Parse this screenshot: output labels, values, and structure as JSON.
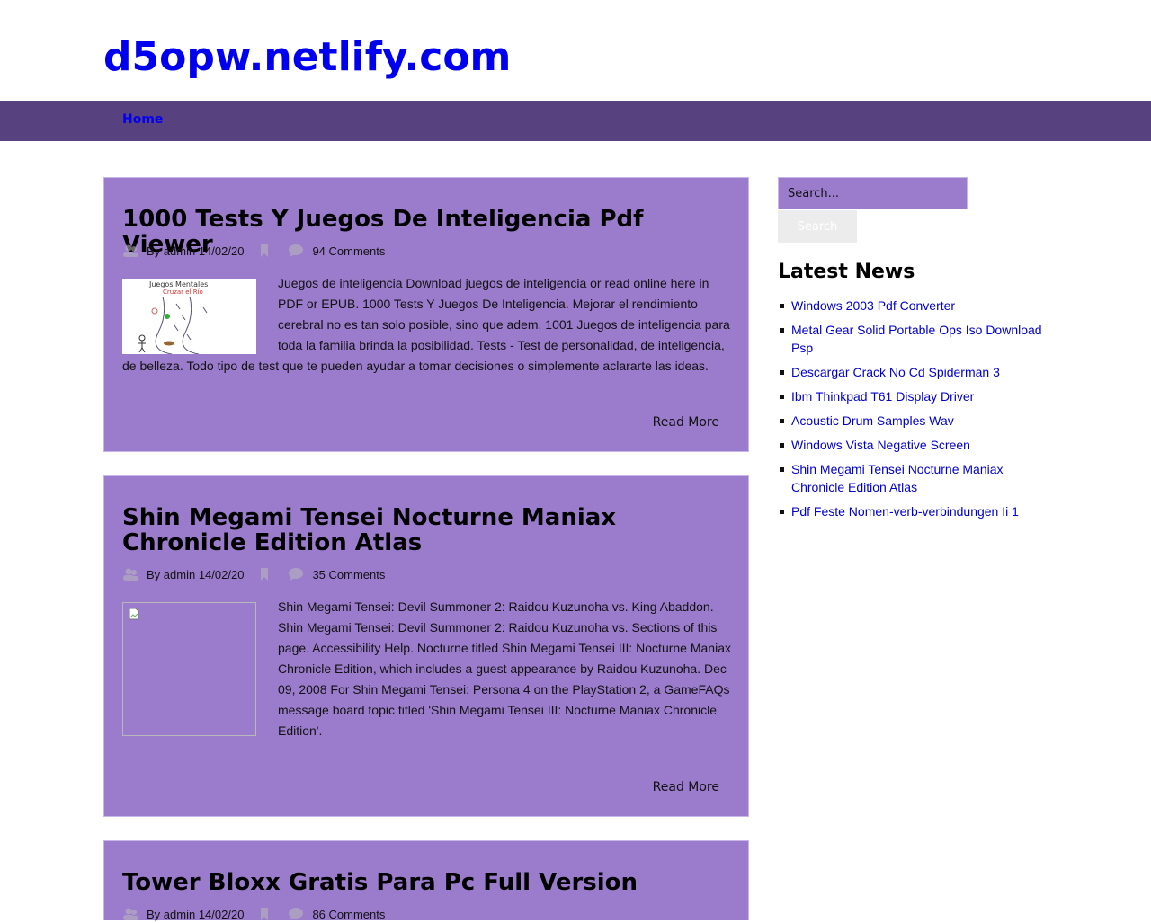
{
  "site": {
    "title": "d5opw.netlify.com"
  },
  "nav": {
    "home": "Home"
  },
  "posts": [
    {
      "title": "1000 Tests Y Juegos De Inteligencia Pdf Viewer",
      "author": "By admin",
      "date": "14/02/20",
      "comments": "94 Comments",
      "excerpt": "Juegos de inteligencia Download juegos de inteligencia or read online here in PDF or EPUB. 1000 Tests Y Juegos De Inteligencia. Mejorar el rendimiento cerebral no es tan solo posible, sino que adem. 1001 Juegos de inteligencia para toda la familia brinda la posibilidad. Tests - Test de personalidad, de inteligencia, de belleza. Todo tipo de test que te pueden ayudar a tomar decisiones o simplemente aclararte las ideas.",
      "thumb_text": [
        "Juegos Mentales",
        "Cruzar el Río"
      ],
      "read_more": "Read More"
    },
    {
      "title": "Shin Megami Tensei Nocturne Maniax Chronicle Edition Atlas",
      "author": "By admin",
      "date": "14/02/20",
      "comments": "35 Comments",
      "excerpt": "Shin Megami Tensei: Devil Summoner 2: Raidou Kuzunoha vs. King Abaddon. Shin Megami Tensei: Devil Summoner 2: Raidou Kuzunoha vs. Sections of this page. Accessibility Help. Nocturne titled Shin Megami Tensei III: Nocturne Maniax Chronicle Edition, which includes a guest appearance by Raidou Kuzunoha. Dec 09, 2008  For Shin Megami Tensei: Persona 4 on the PlayStation 2, a GameFAQs message board topic titled 'Shin Megami Tensei III: Nocturne Maniax Chronicle Edition'.",
      "read_more": "Read More"
    },
    {
      "title": "Tower Bloxx Gratis Para Pc Full Version",
      "author": "By admin",
      "date": "14/02/20",
      "comments": "86 Comments"
    }
  ],
  "sidebar": {
    "search_placeholder": "Search...",
    "search_button": "Search",
    "latest_title": "Latest News",
    "news": [
      "Windows 2003 Pdf Converter",
      "Metal Gear Solid Portable Ops Iso Download Psp",
      "Descargar Crack No Cd Spiderman 3",
      "Ibm Thinkpad T61 Display Driver",
      "Acoustic Drum Samples Wav",
      "Windows Vista Negative Screen",
      "Shin Megami Tensei Nocturne Maniax Chronicle Edition Atlas",
      "Pdf Feste Nomen-verb-verbindungen Ii 1"
    ]
  },
  "colors": {
    "link": "#0000ee",
    "nav_bar": "#58417f",
    "post_bg": "#9b7ccc"
  },
  "icons": [
    "user-icon",
    "bookmark-icon",
    "comment-icon",
    "broken-image-icon"
  ]
}
